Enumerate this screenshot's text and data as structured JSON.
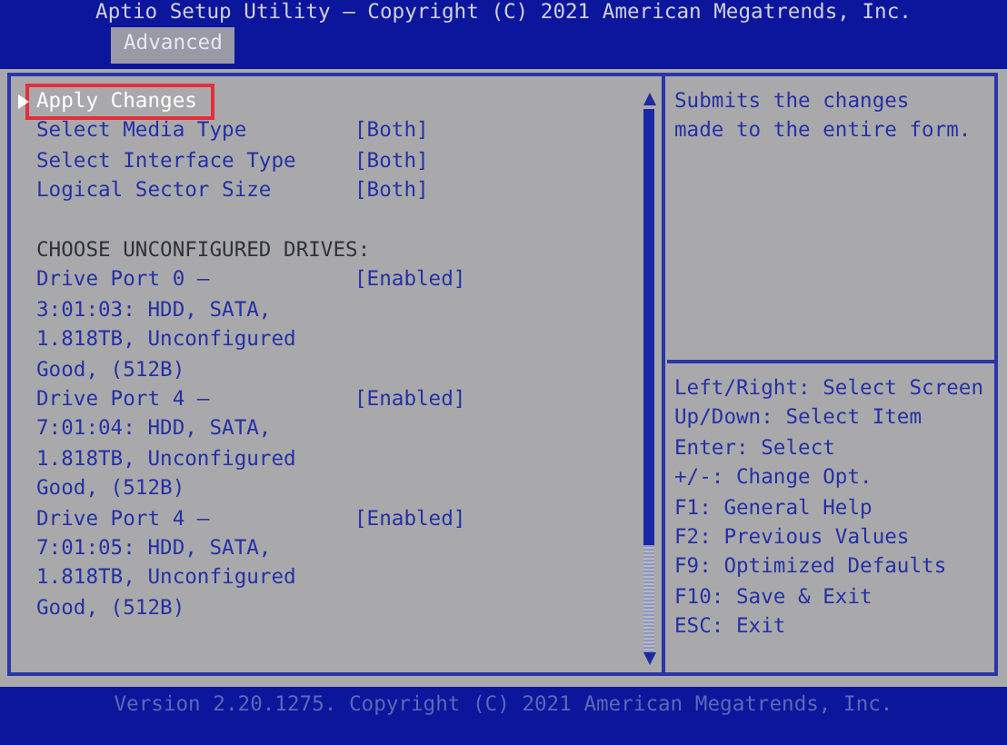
{
  "window": {
    "title": "Aptio Setup Utility – Copyright (C) 2021 American Megatrends, Inc."
  },
  "tabs": [
    {
      "label": "Advanced",
      "selected": true
    }
  ],
  "items": [
    {
      "kind": "action",
      "label": [
        "Apply Changes"
      ],
      "selected": true
    },
    {
      "kind": "option",
      "label": [
        "Select Media Type"
      ],
      "value": "[Both]",
      "selected": false
    },
    {
      "kind": "option",
      "label": [
        "Select Interface Type"
      ],
      "value": "[Both]",
      "selected": false
    },
    {
      "kind": "option",
      "label": [
        "Logical Sector Size"
      ],
      "value": "[Both]",
      "selected": false
    },
    {
      "kind": "heading",
      "label": [
        "CHOOSE UNCONFIGURED DRIVES:"
      ]
    },
    {
      "kind": "option",
      "label": [
        "Drive Port 0 –",
        "3:01:03: HDD, SATA,",
        "1.818TB, Unconfigured",
        "Good, (512B)"
      ],
      "value": "[Enabled]",
      "selected": false
    },
    {
      "kind": "option",
      "label": [
        "Drive Port 4 –",
        "7:01:04: HDD, SATA,",
        "1.818TB, Unconfigured",
        "Good, (512B)"
      ],
      "value": "[Enabled]",
      "selected": false
    },
    {
      "kind": "option",
      "label": [
        "Drive Port 4 –",
        "7:01:05: HDD, SATA,",
        "1.818TB, Unconfigured",
        "Good, (512B)"
      ],
      "value": "[Enabled]",
      "selected": false
    }
  ],
  "help_text": [
    "Submits the changes",
    "made to the entire form."
  ],
  "key_help": [
    "Left/Right: Select Screen",
    "Up/Down: Select Item",
    "Enter: Select",
    "+/-: Change Opt.",
    "F1: General Help",
    "F2: Previous Values",
    "F9: Optimized Defaults",
    "F10: Save & Exit",
    "ESC: Exit"
  ],
  "footer": "Version 2.20.1275. Copyright (C) 2021 American Megatrends, Inc."
}
